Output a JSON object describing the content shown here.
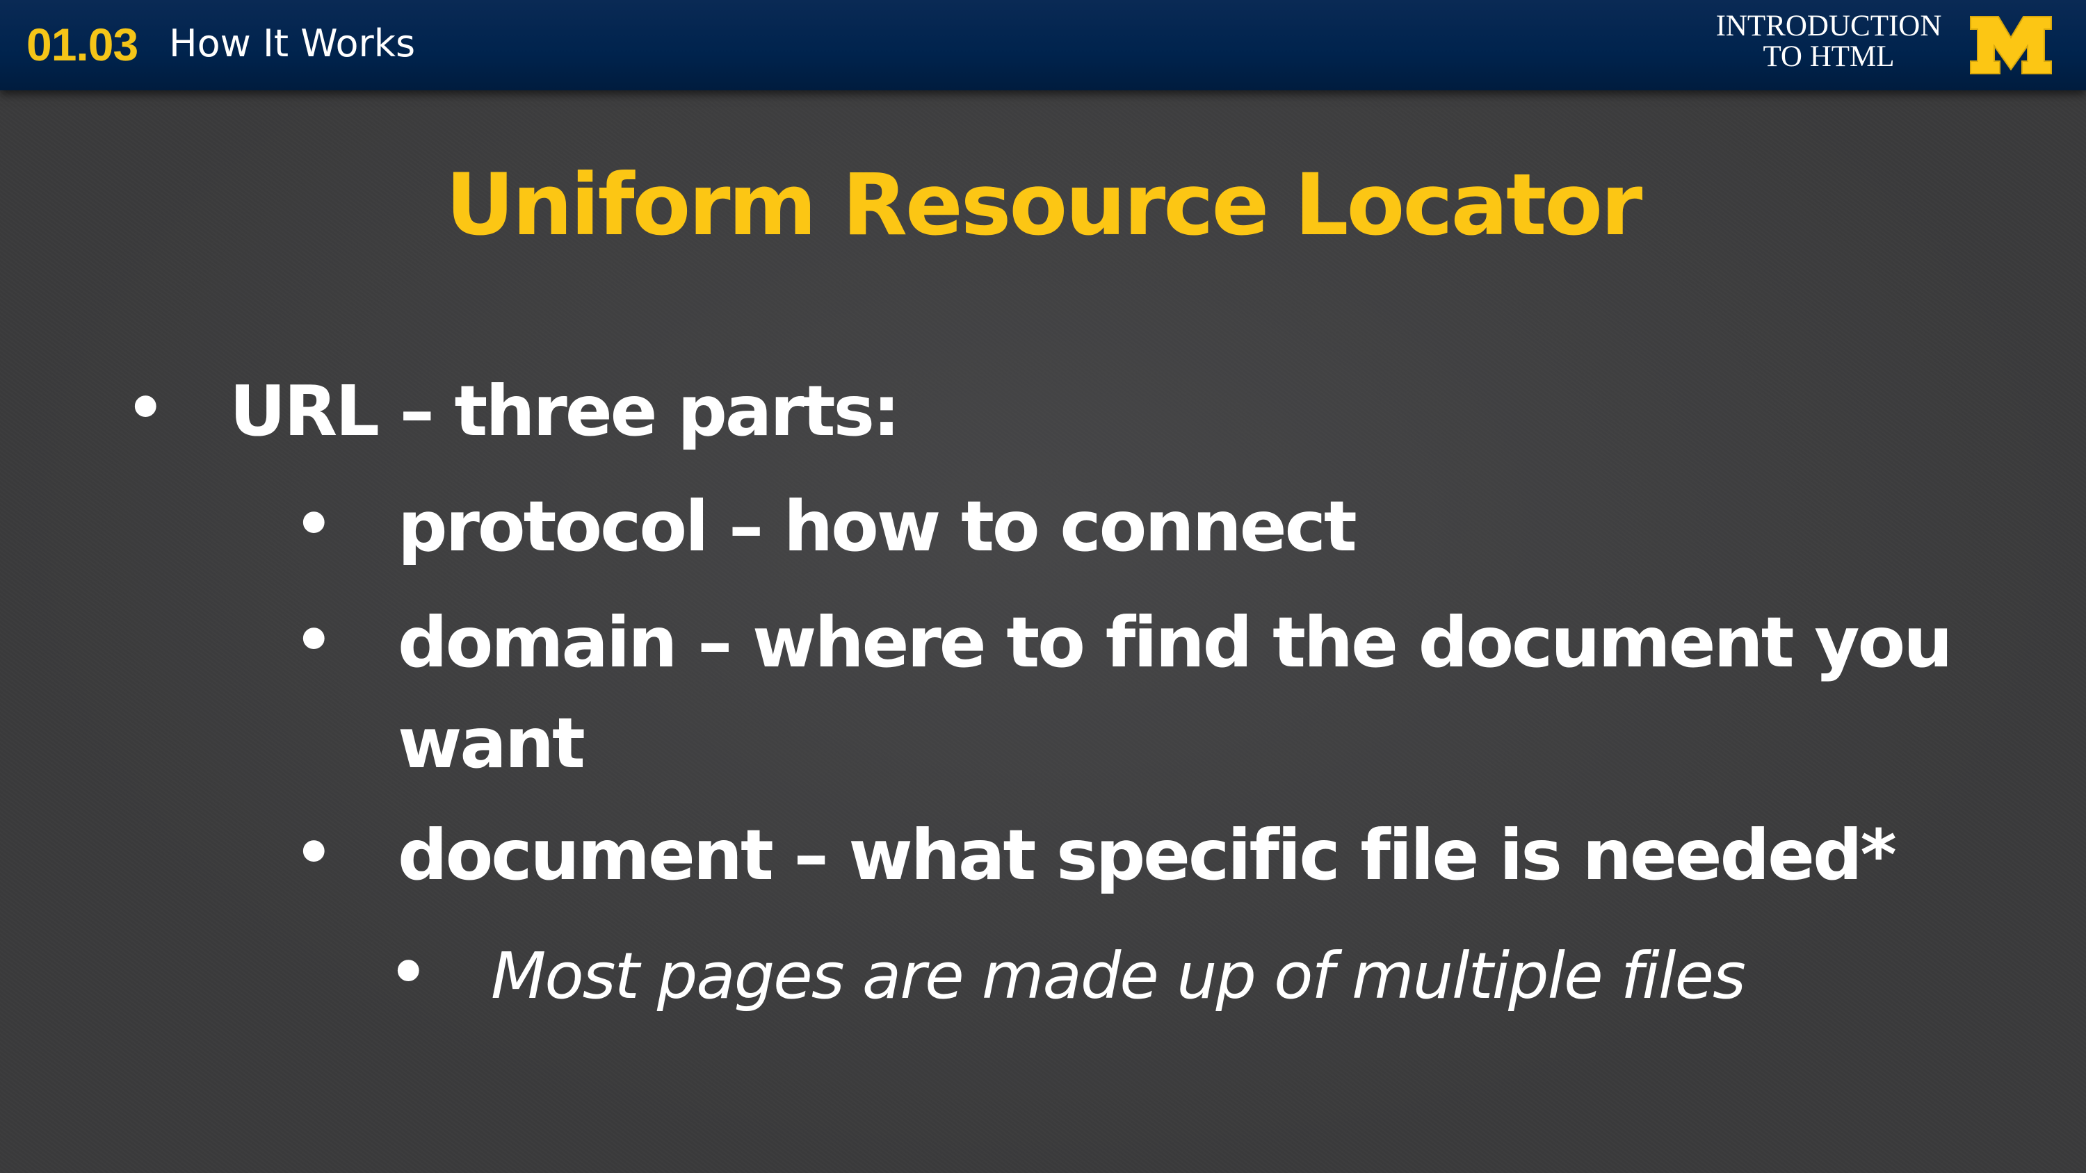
{
  "header": {
    "section_number": "01.03",
    "section_title": "How It Works",
    "course_line1": "INTRODUCTION",
    "course_line2": "TO HTML",
    "logo_icon": "block-m-logo-icon",
    "logo_text": "M"
  },
  "colors": {
    "header_bg": "#00234d",
    "accent": "#fcc614",
    "slide_bg": "#3b3b3c",
    "text": "#ffffff"
  },
  "slide": {
    "title": "Uniform Resource Locator",
    "bullets": {
      "b1": "URL – three parts:",
      "b1_1": "protocol – how to connect",
      "b1_2_line1": "domain – where to find the document you",
      "b1_2_line2": "want",
      "b1_3": "document – what specific file is needed*",
      "b1_3_1": "Most pages are made up of multiple files"
    },
    "bullet_glyph": "•"
  }
}
